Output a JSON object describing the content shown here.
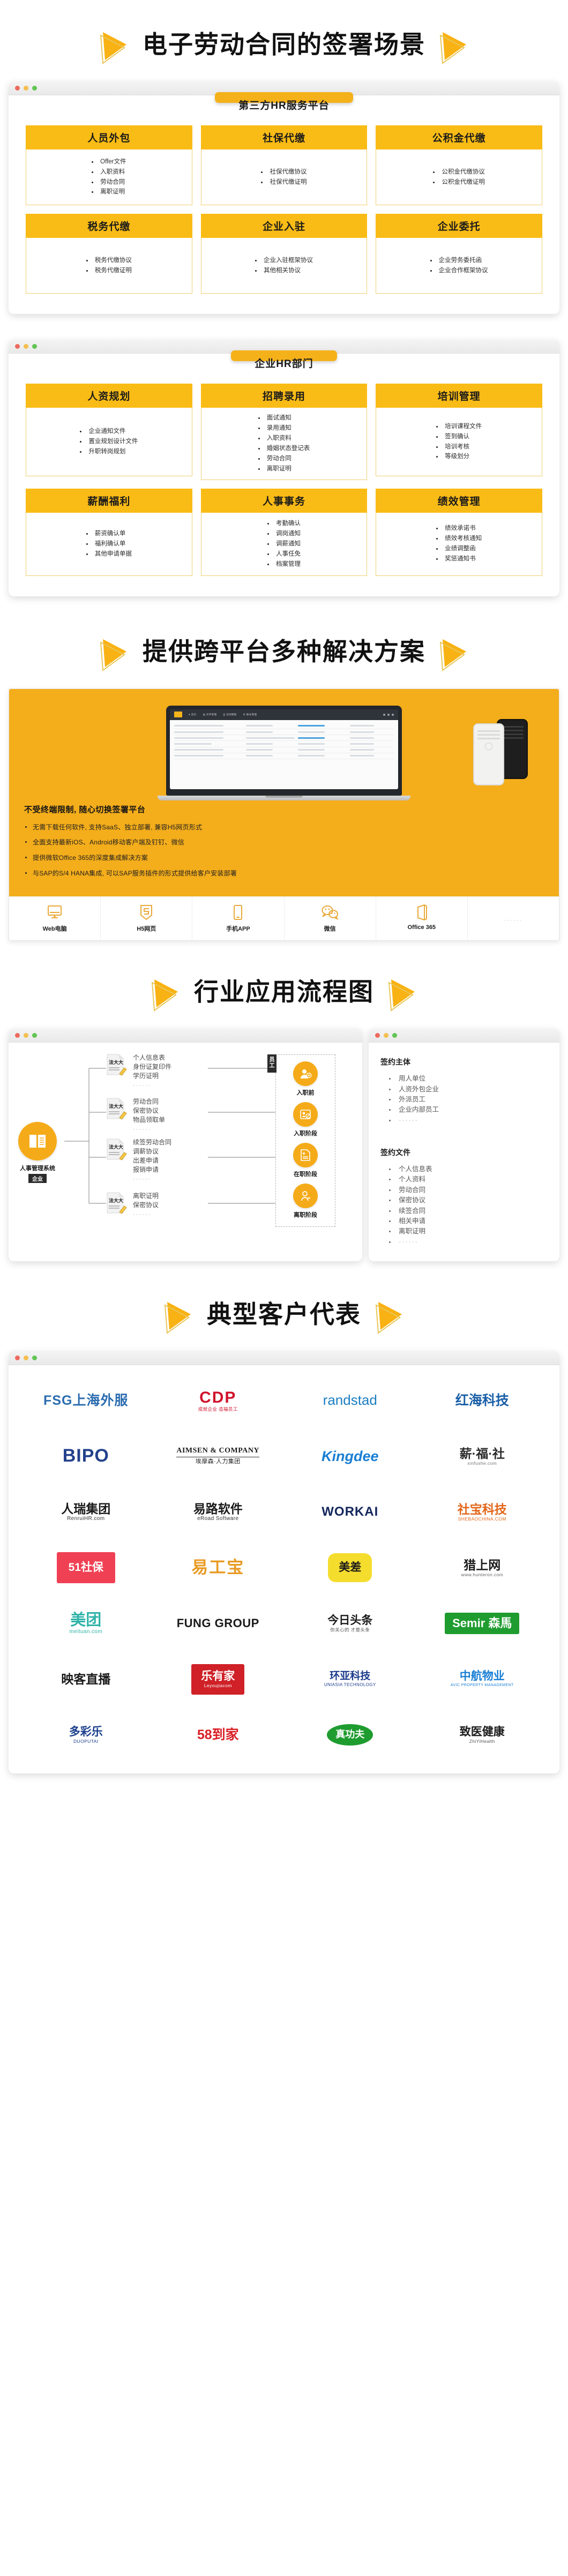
{
  "sections": {
    "s1_title": "电子劳动合同的签署场景",
    "s2_title": "提供跨平台多种解决方案",
    "s3_title": "行业应用流程图",
    "s4_title": "典型客户代表"
  },
  "card1": {
    "pill": "第三方HR服务平台",
    "tiles": [
      {
        "head": "人员外包",
        "items": [
          "Offer文件",
          "入职资料",
          "劳动合同",
          "离职证明"
        ]
      },
      {
        "head": "社保代缴",
        "items": [
          "社保代缴协议",
          "社保代缴证明"
        ]
      },
      {
        "head": "公积金代缴",
        "items": [
          "公积金代缴协议",
          "公积金代缴证明"
        ]
      },
      {
        "head": "税务代缴",
        "items": [
          "税务代缴协议",
          "税务代缴证明"
        ]
      },
      {
        "head": "企业入驻",
        "items": [
          "企业入驻框架协议",
          "其他相关协议"
        ]
      },
      {
        "head": "企业委托",
        "items": [
          "企业劳务委托函",
          "企业合作框架协议"
        ]
      }
    ]
  },
  "card2": {
    "pill": "企业HR部门",
    "tiles": [
      {
        "head": "人资规划",
        "items": [
          "企业通知文件",
          "置业规划设计文件",
          "升职转岗规划"
        ]
      },
      {
        "head": "招聘录用",
        "items": [
          "面试通知",
          "录用通知",
          "入职资料",
          "婚姻状态登记表",
          "劳动合同",
          "离职证明"
        ]
      },
      {
        "head": "培训管理",
        "items": [
          "培训课程文件",
          "签到确认",
          "培训考核",
          "等级划分"
        ]
      },
      {
        "head": "薪酬福利",
        "items": [
          "薪资确认单",
          "福利确认单",
          "其他申请单据"
        ]
      },
      {
        "head": "人事事务",
        "items": [
          "考勤确认",
          "调岗通知",
          "调薪通知",
          "人事任免",
          "档案管理"
        ]
      },
      {
        "head": "绩效管理",
        "items": [
          "绩效承诺书",
          "绩效考核通知",
          "业绩调整函",
          "奖惩通知书"
        ]
      }
    ]
  },
  "xplat": {
    "lead": "不受终端限制, 随心切换签署平台",
    "bullets": [
      "无需下载任何软件, 支持SaaS、独立部署, 兼容H5网页形式",
      "全面支持最新iOS、Android移动客户端及钉钉、微信",
      "提供微软Office 365的深度集成解决方案",
      "与SAP的S/4 HANA集成, 可以SAP服务插件的形式提供给客户安装部署"
    ],
    "platforms": [
      {
        "icon": "monitor-icon",
        "label": "Web电脑"
      },
      {
        "icon": "html5-icon",
        "label": "H5网页"
      },
      {
        "icon": "phone-icon",
        "label": "手机APP"
      },
      {
        "icon": "wechat-icon",
        "label": "微信"
      },
      {
        "icon": "office-icon",
        "label": "Office 365"
      },
      {
        "icon": "ellipsis-icon",
        "label": "······"
      }
    ]
  },
  "flow": {
    "hub_label": "人事管理系统",
    "hub_tag": "企业",
    "stage_tag": "员工",
    "branches": [
      {
        "lines": [
          "个人信息表",
          "身份证复印件",
          "学历证明"
        ],
        "dots": "······"
      },
      {
        "lines": [
          "劳动合同",
          "保密协议",
          "物品领取单"
        ],
        "dots": "······"
      },
      {
        "lines": [
          "续签劳动合同",
          "调薪协议",
          "出差申请",
          "报销申请"
        ],
        "dots": "······"
      },
      {
        "lines": [
          "离职证明",
          "保密协议"
        ],
        "dots": "······"
      }
    ],
    "stages": [
      {
        "icon": "user-add-icon",
        "label": "入职前"
      },
      {
        "icon": "badge-icon",
        "label": "入职阶段"
      },
      {
        "icon": "document-icon",
        "label": "在职阶段"
      },
      {
        "icon": "user-minus-icon",
        "label": "离职阶段"
      }
    ],
    "panel": {
      "h1": "签约主体",
      "list1": [
        "用人单位",
        "人资外包企业",
        "外派员工",
        "企业内部员工",
        "······"
      ],
      "h2": "签约文件",
      "list2": [
        "个人信息表",
        "个人资料",
        "劳动合同",
        "保密协议",
        "续签合同",
        "相关申请",
        "离职证明",
        "······"
      ]
    }
  },
  "clients": [
    {
      "name": "FSG上海外服",
      "main": "FSG",
      "cn": "上海外服",
      "color": "#2b6cb0",
      "style": "fsg"
    },
    {
      "name": "CDP",
      "main": "CDP",
      "sub": "成就企业  造福员工",
      "color": "#d0112b",
      "style": "cdp"
    },
    {
      "name": "randstad",
      "main": "randstad",
      "color": "#1b7ec1",
      "style": "randstad"
    },
    {
      "name": "红海科技",
      "main": "红海科技",
      "color": "#1a5fa8",
      "style": "honghai"
    },
    {
      "name": "BIPO",
      "main": "BIPO",
      "color": "#23418c",
      "style": "plain"
    },
    {
      "name": "AIMSEN & COMPANY",
      "main": "AIMSEN & COMPANY",
      "sub": "埃摩森·人力集团",
      "color": "#1a1a1a",
      "style": "aimsen"
    },
    {
      "name": "Kingdee",
      "main": "Kingdee",
      "color": "#1a7fd4",
      "style": "kingdee"
    },
    {
      "name": "薪福社",
      "main": "薪·福·社",
      "sub": "xinfushe.com",
      "color": "#2b2b2b",
      "style": "xinfushe"
    },
    {
      "name": "人瑞集团",
      "main": "人瑞集团",
      "sub": "RenruiHR.com",
      "color": "#1a1a1a",
      "style": "renrui"
    },
    {
      "name": "易路软件",
      "main": "易路软件",
      "sub": "eRoad Software",
      "color": "#1a1a1a",
      "style": "eroad"
    },
    {
      "name": "WORKAI",
      "main": "WORKAI",
      "color": "#14265c",
      "style": "workai"
    },
    {
      "name": "社宝科技",
      "main": "社宝科技",
      "sub": "SHEBAOCHINA.COM",
      "color": "#e2661a",
      "style": "shebao"
    },
    {
      "name": "51社保",
      "main": "51社保",
      "color": "#ffffff",
      "style": "badge-red"
    },
    {
      "name": "易工宝",
      "main": "易工宝",
      "color": "#e89a22",
      "style": "yigongbao"
    },
    {
      "name": "美差",
      "main": "美差",
      "color": "#1a1a1a",
      "style": "badge-yellow"
    },
    {
      "name": "猎上网",
      "main": "猎上网",
      "sub": "www.hunteron.com",
      "color": "#1a1a1a",
      "style": "hunteron"
    },
    {
      "name": "美团",
      "main": "美团",
      "sub": "meituan.com",
      "color": "#2fb3a8",
      "style": "meituan"
    },
    {
      "name": "FUNG GROUP",
      "main": "FUNG GROUP",
      "color": "#1a1a1a",
      "style": "fung"
    },
    {
      "name": "今日头条",
      "main": "今日头条",
      "sub": "你关心的 才是头条",
      "color": "#1a1a1a",
      "style": "toutiao"
    },
    {
      "name": "Semir森马",
      "main": "Semir 森馬",
      "color": "#ffffff",
      "style": "badge-green"
    },
    {
      "name": "映客直播",
      "main": "映客直播",
      "color": "#1a1a1a",
      "style": "yingke"
    },
    {
      "name": "乐有家",
      "main": "乐有家",
      "sub": "Leyoujiacom",
      "color": "#ffffff",
      "style": "badge-crimson"
    },
    {
      "name": "环亚科技",
      "main": "环亚科技",
      "sub": "UNIASIA TECHNOLOGY",
      "color": "#1b3a8c",
      "style": "uniasia"
    },
    {
      "name": "中航物业",
      "main": "中航物业",
      "sub": "AVIC PROPERTY MANAGEMENT",
      "color": "#1a7fd4",
      "style": "avic"
    },
    {
      "name": "多彩乐",
      "main": "多彩乐",
      "sub": "DUOPUTAI",
      "color": "#1a3f8c",
      "style": "duoputai"
    },
    {
      "name": "58到家",
      "main": "58到家",
      "color": "#d91f26",
      "style": "to58"
    },
    {
      "name": "真功夫",
      "main": "真功夫",
      "color": "#ffffff",
      "style": "badge-kungfu"
    },
    {
      "name": "致医健康",
      "main": "致医健康",
      "sub": "ZhiYiHealth",
      "color": "#1a1a1a",
      "style": "zhiyi"
    }
  ]
}
